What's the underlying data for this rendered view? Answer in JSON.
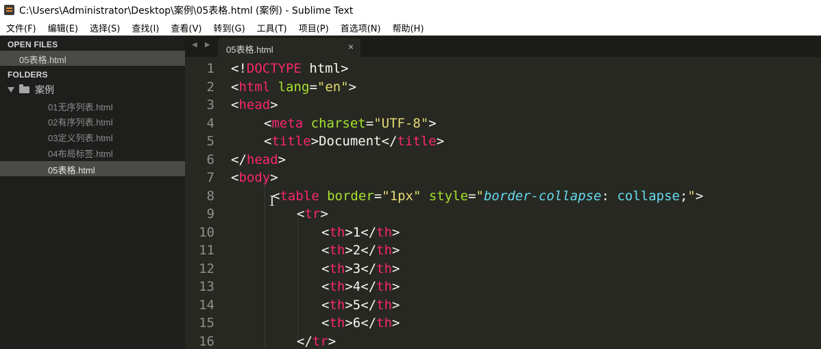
{
  "window": {
    "title": "C:\\Users\\Administrator\\Desktop\\案例\\05表格.html (案例) - Sublime Text"
  },
  "menu": [
    "文件(F)",
    "编辑(E)",
    "选择(S)",
    "查找(I)",
    "查看(V)",
    "转到(G)",
    "工具(T)",
    "项目(P)",
    "首选项(N)",
    "帮助(H)"
  ],
  "sidebar": {
    "open_files_header": "OPEN FILES",
    "open_file": "05表格.html",
    "folders_header": "FOLDERS",
    "folder_name": "案例",
    "files": [
      "01无序列表.html",
      "02有序列表.html",
      "03定义列表.html",
      "04布局标签.html"
    ],
    "selected_file": "05表格.html"
  },
  "tabs": {
    "nav_arrows": "◀ ▶",
    "active_label": "05表格.html",
    "close_glyph": "×"
  },
  "editor": {
    "line_numbers": [
      "1",
      "2",
      "3",
      "4",
      "5",
      "6",
      "7",
      "8",
      "9",
      "10",
      "11",
      "12",
      "13",
      "14",
      "15",
      "16"
    ],
    "code": {
      "l1": {
        "open": "<!",
        "tag": "DOCTYPE",
        "rest": " html>"
      },
      "l2": {
        "open": "<",
        "tag": "html",
        "sp": " ",
        "attr": "lang",
        "eq": "=",
        "val": "\"en\"",
        "close": ">"
      },
      "l3": {
        "open": "<",
        "tag": "head",
        "close": ">"
      },
      "l4": {
        "open": "<",
        "tag": "meta",
        "sp": " ",
        "attr": "charset",
        "eq": "=",
        "val": "\"UTF-8\"",
        "close": ">"
      },
      "l5": {
        "open": "<",
        "tag": "title",
        "close": ">",
        "text": "Document",
        "open2": "</",
        "tag2": "title",
        "close2": ">"
      },
      "l6": {
        "open": "</",
        "tag": "head",
        "close": ">"
      },
      "l7": {
        "open": "<",
        "tag": "body",
        "close": ">"
      },
      "l8": {
        "open": "<",
        "tag": "table",
        "sp": " ",
        "attr": "border",
        "eq": "=",
        "val": "\"1px\"",
        "sp2": " ",
        "attr2": "style",
        "eq2": "=",
        "q1": "\"",
        "cssprop": "border-collapse",
        "colon": ": ",
        "cssval": "collapse",
        "semi": ";",
        "q2": "\"",
        "close": ">"
      },
      "l9": {
        "open": "<",
        "tag": "tr",
        "close": ">"
      },
      "th_rows": [
        {
          "open": "<",
          "tag": "th",
          "close": ">",
          "text": "1",
          "open2": "</",
          "tag2": "th",
          "close2": ">"
        },
        {
          "open": "<",
          "tag": "th",
          "close": ">",
          "text": "2",
          "open2": "</",
          "tag2": "th",
          "close2": ">"
        },
        {
          "open": "<",
          "tag": "th",
          "close": ">",
          "text": "3",
          "open2": "</",
          "tag2": "th",
          "close2": ">"
        },
        {
          "open": "<",
          "tag": "th",
          "close": ">",
          "text": "4",
          "open2": "</",
          "tag2": "th",
          "close2": ">"
        },
        {
          "open": "<",
          "tag": "th",
          "close": ">",
          "text": "5",
          "open2": "</",
          "tag2": "th",
          "close2": ">"
        },
        {
          "open": "<",
          "tag": "th",
          "close": ">",
          "text": "6",
          "open2": "</",
          "tag2": "th",
          "close2": ">"
        }
      ],
      "l16": {
        "open": "</",
        "tag": "tr",
        "close": ">"
      }
    }
  },
  "colors": {
    "background": "#272822",
    "tag": "#f92672",
    "attribute": "#a6e22e",
    "string": "#e6db74",
    "css": "#66d9ef",
    "text": "#f8f8f2",
    "line_number": "#8f908a"
  }
}
